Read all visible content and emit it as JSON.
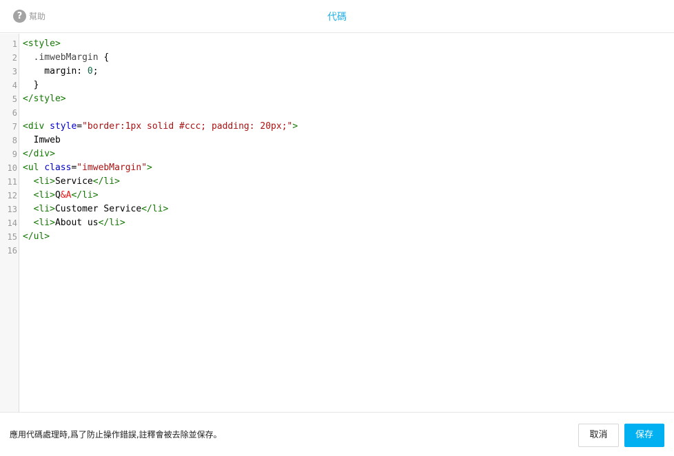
{
  "header": {
    "help_label": "幫助",
    "help_icon_glyph": "?",
    "title": "代碼"
  },
  "editor": {
    "line_numbers": [
      "1",
      "2",
      "3",
      "4",
      "5",
      "6",
      "7",
      "8",
      "9",
      "10",
      "11",
      "12",
      "13",
      "14",
      "15",
      "16"
    ],
    "lines": [
      [
        {
          "t": "tag",
          "v": "<style>"
        }
      ],
      [
        {
          "t": "sel",
          "v": "  .imwebMargin "
        },
        {
          "t": "txt",
          "v": "{"
        }
      ],
      [
        {
          "t": "txt",
          "v": "    margin: "
        },
        {
          "t": "num",
          "v": "0"
        },
        {
          "t": "txt",
          "v": ";"
        }
      ],
      [
        {
          "t": "txt",
          "v": "  }"
        }
      ],
      [
        {
          "t": "tag",
          "v": "</style>"
        }
      ],
      [],
      [
        {
          "t": "tag",
          "v": "<div "
        },
        {
          "t": "attr",
          "v": "style"
        },
        {
          "t": "txt",
          "v": "="
        },
        {
          "t": "str",
          "v": "\"border:1px solid #ccc; padding: 20px;\""
        },
        {
          "t": "tag",
          "v": ">"
        }
      ],
      [
        {
          "t": "txt",
          "v": "  Imweb"
        }
      ],
      [
        {
          "t": "tag",
          "v": "</div>"
        }
      ],
      [
        {
          "t": "tag",
          "v": "<ul "
        },
        {
          "t": "attr",
          "v": "class"
        },
        {
          "t": "txt",
          "v": "="
        },
        {
          "t": "str",
          "v": "\"imwebMargin\""
        },
        {
          "t": "tag",
          "v": ">"
        }
      ],
      [
        {
          "t": "txt",
          "v": "  "
        },
        {
          "t": "tag",
          "v": "<li>"
        },
        {
          "t": "txt",
          "v": "Service"
        },
        {
          "t": "tag",
          "v": "</li>"
        }
      ],
      [
        {
          "t": "txt",
          "v": "  "
        },
        {
          "t": "tag",
          "v": "<li>"
        },
        {
          "t": "txt",
          "v": "Q"
        },
        {
          "t": "ent",
          "v": "&A"
        },
        {
          "t": "tag",
          "v": "</li>"
        }
      ],
      [
        {
          "t": "txt",
          "v": "  "
        },
        {
          "t": "tag",
          "v": "<li>"
        },
        {
          "t": "txt",
          "v": "Customer Service"
        },
        {
          "t": "tag",
          "v": "</li>"
        }
      ],
      [
        {
          "t": "txt",
          "v": "  "
        },
        {
          "t": "tag",
          "v": "<li>"
        },
        {
          "t": "txt",
          "v": "About us"
        },
        {
          "t": "tag",
          "v": "</li>"
        }
      ],
      [
        {
          "t": "tag",
          "v": "</ul>"
        }
      ],
      []
    ]
  },
  "footer": {
    "notice": "應用代碼處理時,爲了防止操作錯誤,註釋會被去除並保存。",
    "cancel_label": "取消",
    "save_label": "保存"
  },
  "colors": {
    "accent": "#22b1e6",
    "save_button": "#00b0f0",
    "tag": "#117700",
    "attribute": "#0000cc",
    "string": "#aa1111",
    "number": "#116644",
    "entity": "#ee1111"
  }
}
